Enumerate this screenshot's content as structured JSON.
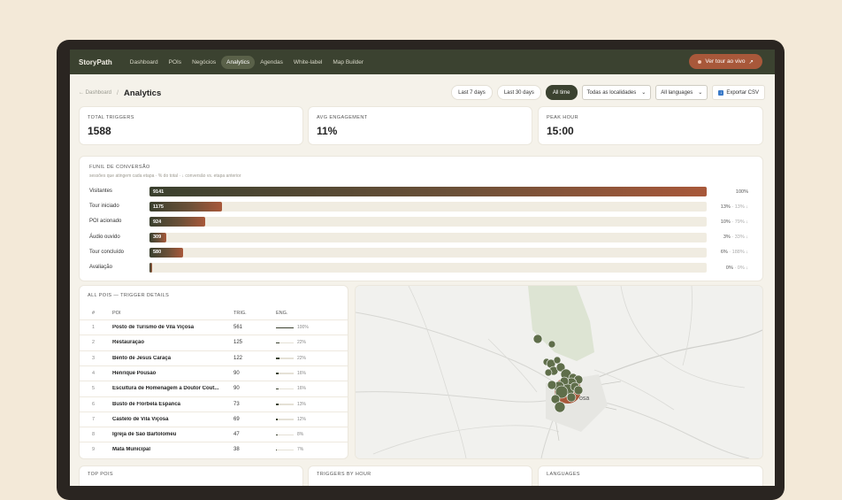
{
  "app": {
    "brand": "StoryPath"
  },
  "nav": [
    {
      "label": "Dashboard",
      "active": false
    },
    {
      "label": "POIs",
      "active": false
    },
    {
      "label": "Negócios",
      "active": false
    },
    {
      "label": "Analytics",
      "active": true
    },
    {
      "label": "Agendas",
      "active": false
    },
    {
      "label": "White-label",
      "active": false
    },
    {
      "label": "Map Builder",
      "active": false
    }
  ],
  "header": {
    "live_button": "Ver tour ao vivo",
    "live_arrow": "↗"
  },
  "breadcrumb": {
    "back": "← Dashboard",
    "sep": "/",
    "title": "Analytics"
  },
  "filters": {
    "last7": "Last 7 days",
    "last30": "Last 30 days",
    "all": "All time",
    "locations": "Todas as localidades",
    "languages": "All languages",
    "export": "Exportar CSV"
  },
  "kpis": [
    {
      "label": "TOTAL TRIGGERS",
      "value": "1588"
    },
    {
      "label": "AVG ENGAGEMENT",
      "value": "11%"
    },
    {
      "label": "PEAK HOUR",
      "value": "15:00"
    }
  ],
  "funnel": {
    "title": "FUNIL DE CONVERSÃO",
    "subtitle": "sessões que atingem cada etapa · % do total · ↓ conversão vs. etapa anterior",
    "rows": [
      {
        "label": "Visitantes",
        "value": "9141",
        "fraction": 1.0,
        "pct": "100%",
        "conv": ""
      },
      {
        "label": "Tour iniciado",
        "value": "1175",
        "fraction": 0.13,
        "pct": "13%",
        "conv": " · 13% ↓"
      },
      {
        "label": "POI acionado",
        "value": "924",
        "fraction": 0.1,
        "pct": "10%",
        "conv": " · 79% ↓"
      },
      {
        "label": "Áudio ouvido",
        "value": "309",
        "fraction": 0.03,
        "pct": "3%",
        "conv": " · 33% ↓"
      },
      {
        "label": "Tour concluído",
        "value": "580",
        "fraction": 0.06,
        "pct": "6%",
        "conv": " · 188% ↓"
      },
      {
        "label": "Avaliação",
        "value": "",
        "fraction": 0.005,
        "pct": "0%",
        "conv": " · 0% ↓"
      }
    ]
  },
  "poi_table": {
    "title": "ALL POIS — TRIGGER DETAILS",
    "headers": {
      "idx": "#",
      "poi": "POI",
      "trig": "TRIG.",
      "eng": "ENG."
    },
    "rows": [
      {
        "idx": "1",
        "name": "Posto de Turismo de Vila Viçosa",
        "trig": "561",
        "eng": 1.0,
        "eng_label": "100%"
      },
      {
        "idx": "2",
        "name": "Restauração",
        "trig": "125",
        "eng": 0.22,
        "eng_label": "22%"
      },
      {
        "idx": "3",
        "name": "Bento de Jesus Caraça",
        "trig": "122",
        "eng": 0.22,
        "eng_label": "22%"
      },
      {
        "idx": "4",
        "name": "Henrique Pousão",
        "trig": "90",
        "eng": 0.16,
        "eng_label": "16%"
      },
      {
        "idx": "5",
        "name": "Escultura de Homenagem a Doutor Cout...",
        "trig": "90",
        "eng": 0.16,
        "eng_label": "16%"
      },
      {
        "idx": "6",
        "name": "Busto de Florbela Espanca",
        "trig": "73",
        "eng": 0.13,
        "eng_label": "13%"
      },
      {
        "idx": "7",
        "name": "Castelo de Vila Viçosa",
        "trig": "69",
        "eng": 0.12,
        "eng_label": "12%"
      },
      {
        "idx": "8",
        "name": "Igreja de São Bartolomeu",
        "trig": "47",
        "eng": 0.08,
        "eng_label": "8%"
      },
      {
        "idx": "9",
        "name": "Mata Municipal",
        "trig": "38",
        "eng": 0.07,
        "eng_label": "7%"
      }
    ]
  },
  "map": {
    "town_label": "osa"
  },
  "bottom_cards": [
    {
      "label": "TOP POIS"
    },
    {
      "label": "TRIGGERS BY HOUR"
    },
    {
      "label": "LANGUAGES"
    }
  ],
  "colors": {
    "nav_bg": "#3b4230",
    "accent": "#a8583a",
    "cluster": "#5f6e4a"
  }
}
